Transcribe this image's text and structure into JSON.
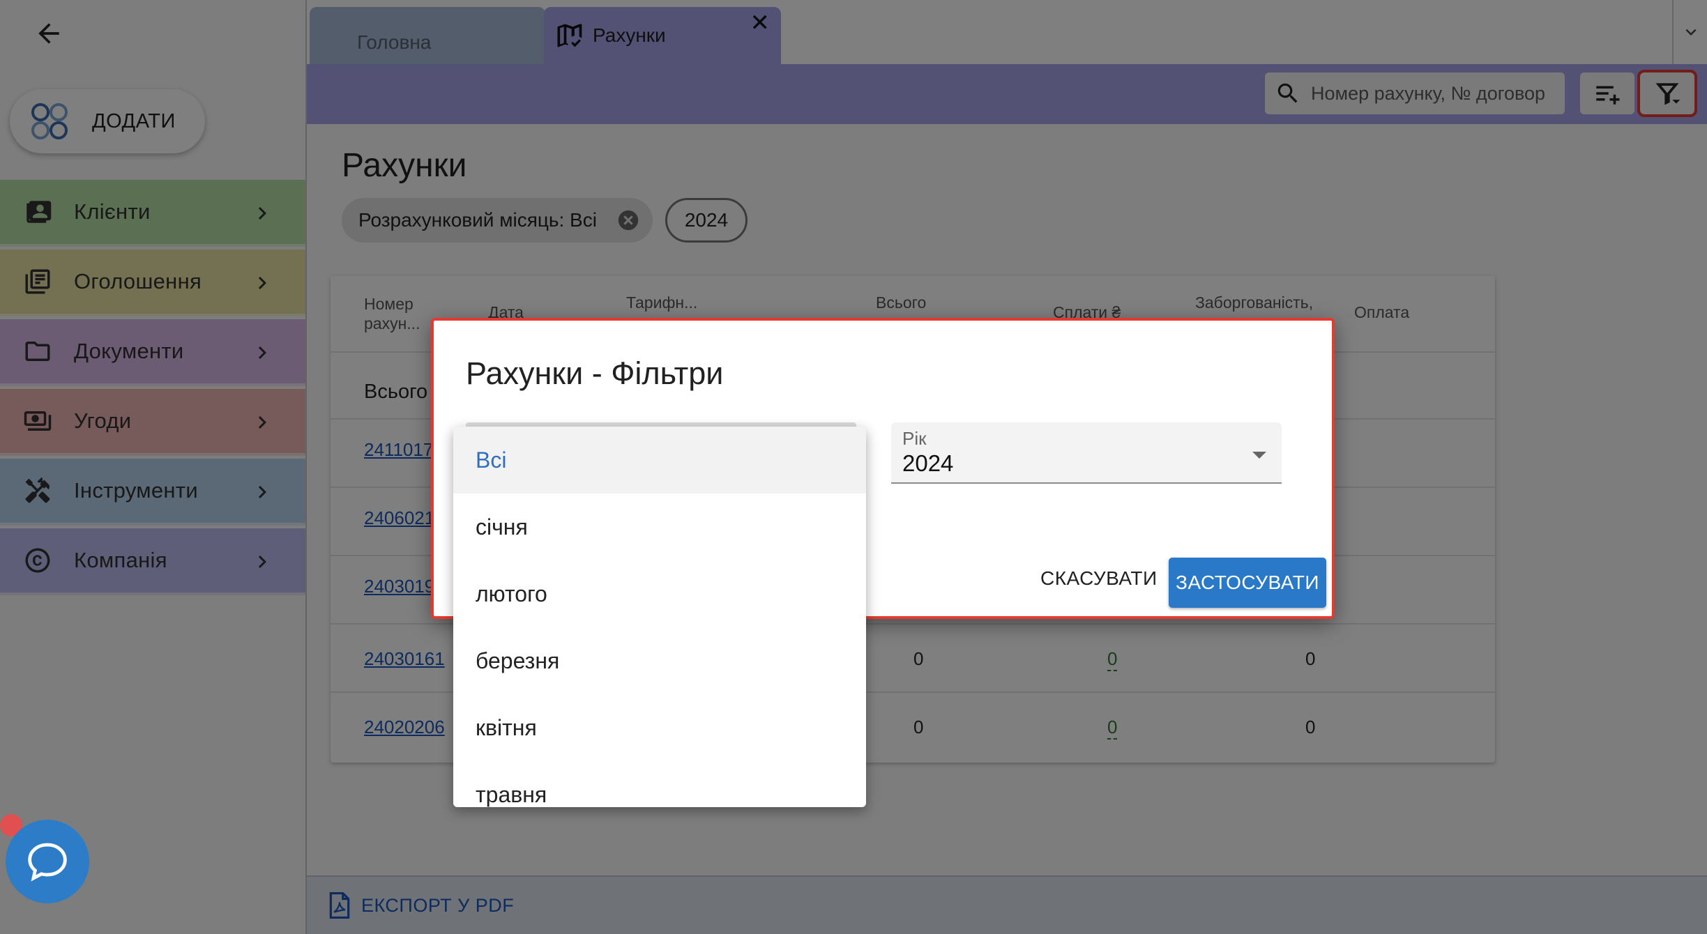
{
  "sidebar": {
    "add_label": "ДОДАТИ",
    "items": [
      {
        "label": "Клієнти",
        "color": "#b7e1a6",
        "icon": "contacts-icon"
      },
      {
        "label": "Оголошення",
        "color": "#e8e3a5",
        "icon": "newspaper-icon"
      },
      {
        "label": "Документи",
        "color": "#d9b8e6",
        "icon": "folder-icon"
      },
      {
        "label": "Угоди",
        "color": "#efb7b7",
        "icon": "money-icon"
      },
      {
        "label": "Інструменти",
        "color": "#b6d2ec",
        "icon": "tools-icon"
      },
      {
        "label": "Компанія",
        "color": "#bdbdf0",
        "icon": "copyright-icon"
      }
    ]
  },
  "tabs": [
    {
      "label": "Головна",
      "active": false
    },
    {
      "label": "Рахунки",
      "active": true,
      "icon": "map-check-icon",
      "close_label": "✕"
    }
  ],
  "toolbar": {
    "search_placeholder": "Номер рахунку, № договор"
  },
  "page": {
    "title": "Рахунки",
    "chips": [
      {
        "label": "Розрахунковий місяць: Всі"
      },
      {
        "label": "2024"
      }
    ]
  },
  "table": {
    "headers": [
      "Номер рахун...",
      "Дата",
      "Тарифн...",
      "Всього",
      "Сплати ₴",
      "Заборгованість,",
      "Оплата"
    ],
    "total_label": "Всього",
    "rows": [
      {
        "number": "2411017",
        "total": "",
        "paid": "",
        "debt": ""
      },
      {
        "number": "2406021",
        "total": "",
        "paid": "",
        "debt": ""
      },
      {
        "number": "2403019",
        "total": "",
        "paid": "",
        "debt": ""
      },
      {
        "number": "24030161",
        "total": "0",
        "paid": "0",
        "debt": "0"
      },
      {
        "number": "24020206",
        "total": "0",
        "paid": "0",
        "debt": "0"
      }
    ]
  },
  "footer": {
    "export_label": "ЕКСПОРТ У PDF"
  },
  "dialog": {
    "title": "Рахунки - Фільтри",
    "year_label": "Рік",
    "year_value": "2024",
    "cancel_label": "СКАСУВАТИ",
    "apply_label": "ЗАСТОСУВАТИ"
  },
  "month_dropdown": {
    "options": [
      "Всі",
      "січня",
      "лютого",
      "березня",
      "квітня",
      "травня"
    ],
    "selected": "Всі"
  },
  "colors": {
    "accent": "#a8a4e8",
    "primary_button": "#2979c8",
    "highlight": "#e53a2f"
  }
}
